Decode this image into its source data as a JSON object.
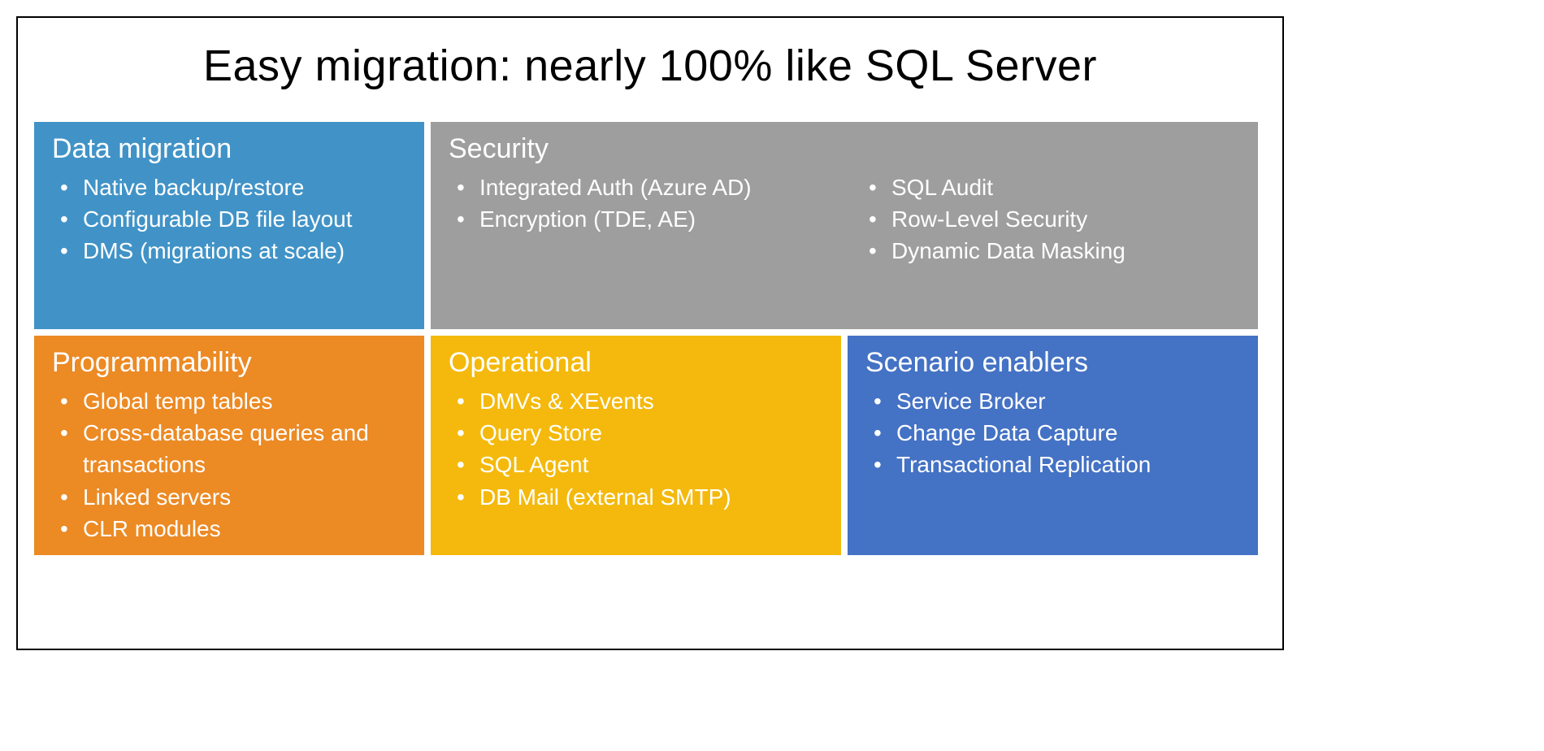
{
  "title": "Easy migration: nearly 100% like SQL Server",
  "blocks": {
    "dataMigration": {
      "title": "Data migration",
      "items": [
        "Native backup/restore",
        "Configurable DB file layout",
        "DMS (migrations at scale)"
      ]
    },
    "security": {
      "title": "Security",
      "col1": [
        "Integrated Auth (Azure AD)",
        "Encryption (TDE, AE)"
      ],
      "col2": [
        "SQL Audit",
        "Row-Level Security",
        "Dynamic Data Masking"
      ]
    },
    "programmability": {
      "title": "Programmability",
      "items": [
        "Global temp tables",
        "Cross-database queries and transactions",
        "Linked servers",
        "CLR modules"
      ]
    },
    "operational": {
      "title": "Operational",
      "items": [
        "DMVs & XEvents",
        "Query Store",
        "SQL Agent",
        "DB Mail (external SMTP)"
      ]
    },
    "scenario": {
      "title": "Scenario enablers",
      "items": [
        "Service Broker",
        "Change Data Capture",
        "Transactional Replication"
      ]
    }
  }
}
